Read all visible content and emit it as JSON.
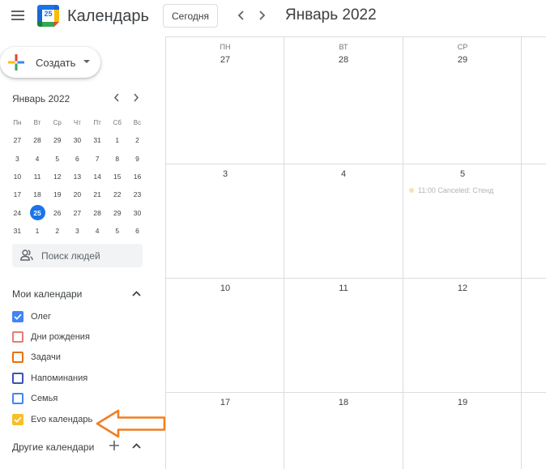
{
  "header": {
    "app_title": "Календарь",
    "logo_day": "25",
    "today_label": "Сегодня",
    "period_title": "Январь 2022",
    "menu_icon": "hamburger-menu-icon",
    "prev_icon": "chevron-left-icon",
    "next_icon": "chevron-right-icon"
  },
  "sidebar": {
    "create_label": "Создать",
    "mini_calendar": {
      "title": "Январь 2022",
      "weekdays": [
        "Пн",
        "Вт",
        "Ср",
        "Чт",
        "Пт",
        "Сб",
        "Вс"
      ],
      "weeks": [
        [
          "27",
          "28",
          "29",
          "30",
          "31",
          "1",
          "2"
        ],
        [
          "3",
          "4",
          "5",
          "6",
          "7",
          "8",
          "9"
        ],
        [
          "10",
          "11",
          "12",
          "13",
          "14",
          "15",
          "16"
        ],
        [
          "17",
          "18",
          "19",
          "20",
          "21",
          "22",
          "23"
        ],
        [
          "24",
          "25",
          "26",
          "27",
          "28",
          "29",
          "30"
        ],
        [
          "31",
          "1",
          "2",
          "3",
          "4",
          "5",
          "6"
        ]
      ],
      "today": "25"
    },
    "people_search_placeholder": "Поиск людей",
    "my_calendars_title": "Мои календари",
    "my_calendars": [
      {
        "name": "Олег",
        "color": "#4285f4",
        "checked": true
      },
      {
        "name": "Дни рождения",
        "color": "#e67c73",
        "checked": false
      },
      {
        "name": "Задачи",
        "color": "#e8710a",
        "checked": false
      },
      {
        "name": "Напоминания",
        "color": "#3f51b5",
        "checked": false
      },
      {
        "name": "Семья",
        "color": "#4285f4",
        "checked": false
      },
      {
        "name": "Evo календарь",
        "color": "#f6bf26",
        "checked": true
      }
    ],
    "other_calendars_title": "Другие календари",
    "annotation_arrow_color": "#f07f22"
  },
  "grid": {
    "columns": [
      {
        "dow": "ПН",
        "dates": [
          "27",
          "3",
          "10",
          "17"
        ]
      },
      {
        "dow": "ВТ",
        "dates": [
          "28",
          "4",
          "11",
          "18"
        ]
      },
      {
        "dow": "СР",
        "dates": [
          "29",
          "5",
          "12",
          "19"
        ]
      }
    ],
    "event": {
      "text": "11:00 Canceled: Стенд",
      "color": "#f6e2b3"
    }
  }
}
